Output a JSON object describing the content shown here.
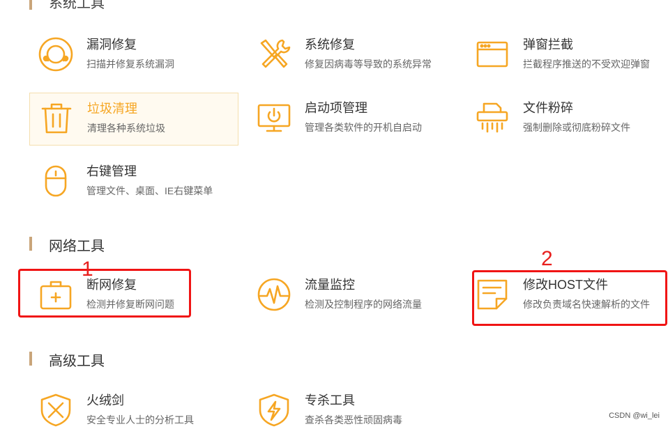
{
  "sections": {
    "system_tools": {
      "label": "系统工具"
    },
    "network_tools": {
      "label": "网络工具"
    },
    "advanced_tools": {
      "label": "高级工具"
    }
  },
  "tools": {
    "vuln_repair": {
      "title": "漏洞修复",
      "desc": "扫描并修复系统漏洞"
    },
    "system_repair": {
      "title": "系统修复",
      "desc": "修复因病毒等导致的系统异常"
    },
    "popup_block": {
      "title": "弹窗拦截",
      "desc": "拦截程序推送的不受欢迎弹窗"
    },
    "junk_clean": {
      "title": "垃圾清理",
      "desc": "清理各种系统垃圾"
    },
    "startup_mgmt": {
      "title": "启动项管理",
      "desc": "管理各类软件的开机自启动"
    },
    "file_shred": {
      "title": "文件粉碎",
      "desc": "强制删除或彻底粉碎文件"
    },
    "context_menu": {
      "title": "右键管理",
      "desc": "管理文件、桌面、IE右键菜单"
    },
    "network_repair": {
      "title": "断网修复",
      "desc": "检测并修复断网问题"
    },
    "traffic_monitor": {
      "title": "流量监控",
      "desc": "检测及控制程序的网络流量"
    },
    "host_edit": {
      "title": "修改HOST文件",
      "desc": "修改负责域名快速解析的文件"
    },
    "tinder_sword": {
      "title": "火绒剑",
      "desc": "安全专业人士的分析工具"
    },
    "special_kill": {
      "title": "专杀工具",
      "desc": "查杀各类恶性顽固病毒"
    }
  },
  "annotations": {
    "n1": "1",
    "n2": "2"
  },
  "watermark": "CSDN @wi_lei",
  "colors": {
    "accent": "#f6a623",
    "annotation": "#f01414",
    "section_bar": "#c9a57a"
  }
}
